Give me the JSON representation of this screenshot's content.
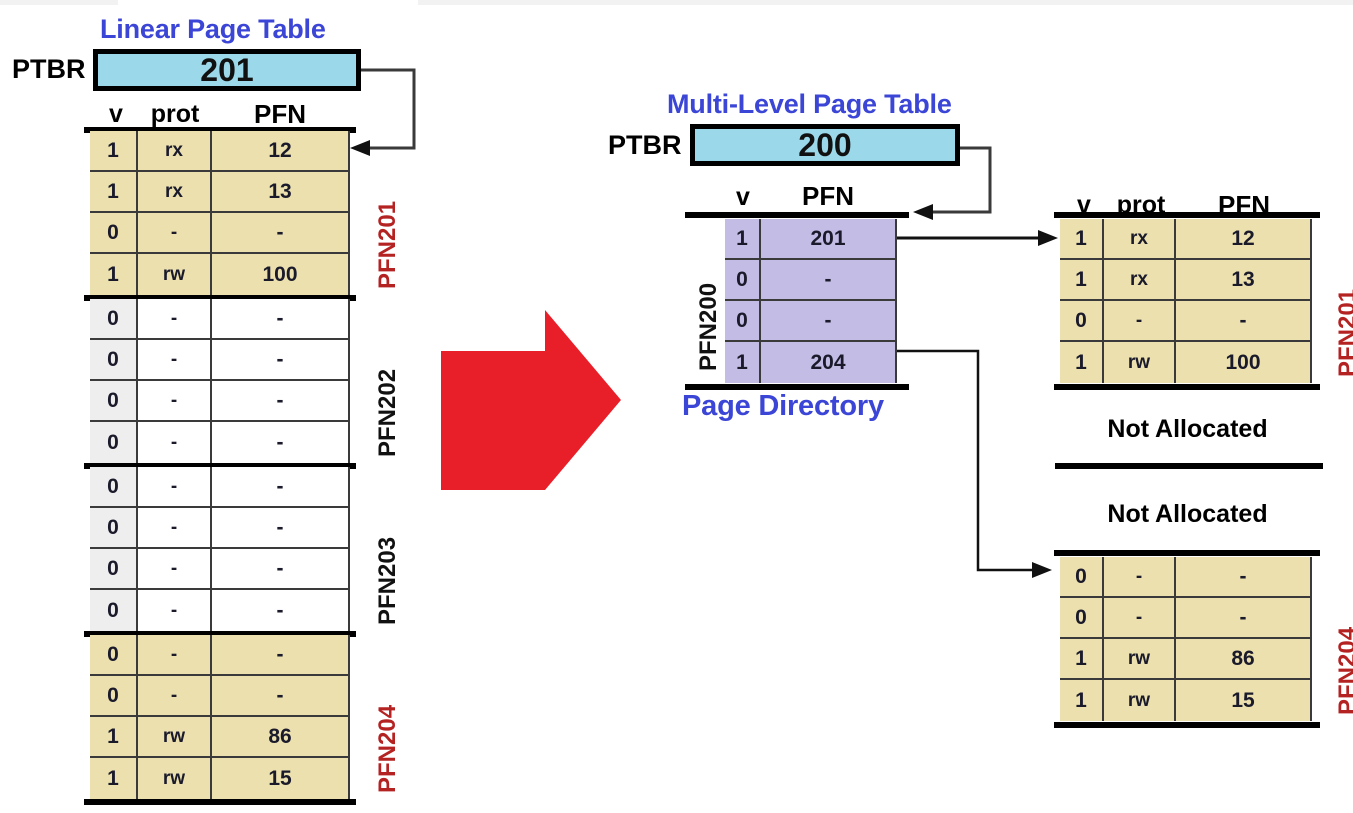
{
  "diagram": {
    "left_title": "Linear Page Table",
    "right_title": "Multi-Level Page Table",
    "page_directory_caption": "Page Directory",
    "not_allocated_1": "Not Allocated",
    "not_allocated_2": "Not Allocated",
    "arrow_icon_name": "red-right-arrow"
  },
  "colors": {
    "title_blue": "#3b45d6",
    "ptbr_fill": "#9bd9ea",
    "table_beige": "#ebe0ae",
    "table_purple": "#c3bce5",
    "table_white": "#ffffff",
    "pfn_label_red": "#b52222",
    "big_arrow_red": "#e81f29",
    "cell_border": "#3a3a3a",
    "section_bar": "#000000"
  },
  "linear": {
    "ptbr_label": "PTBR",
    "ptbr_value": "201",
    "headers": {
      "v": "v",
      "prot": "prot",
      "pfn": "PFN"
    },
    "sections": [
      {
        "pfn_label": "PFN201",
        "label_color": "red",
        "fill": "beige",
        "rows": [
          {
            "v": "1",
            "prot": "rx",
            "pfn": "12"
          },
          {
            "v": "1",
            "prot": "rx",
            "pfn": "13"
          },
          {
            "v": "0",
            "prot": "-",
            "pfn": "-"
          },
          {
            "v": "1",
            "prot": "rw",
            "pfn": "100"
          }
        ]
      },
      {
        "pfn_label": "PFN202",
        "label_color": "black",
        "fill": "white",
        "rows": [
          {
            "v": "0",
            "prot": "-",
            "pfn": "-"
          },
          {
            "v": "0",
            "prot": "-",
            "pfn": "-"
          },
          {
            "v": "0",
            "prot": "-",
            "pfn": "-"
          },
          {
            "v": "0",
            "prot": "-",
            "pfn": "-"
          }
        ]
      },
      {
        "pfn_label": "PFN203",
        "label_color": "black",
        "fill": "white",
        "rows": [
          {
            "v": "0",
            "prot": "-",
            "pfn": "-"
          },
          {
            "v": "0",
            "prot": "-",
            "pfn": "-"
          },
          {
            "v": "0",
            "prot": "-",
            "pfn": "-"
          },
          {
            "v": "0",
            "prot": "-",
            "pfn": "-"
          }
        ]
      },
      {
        "pfn_label": "PFN204",
        "label_color": "red",
        "fill": "beige",
        "rows": [
          {
            "v": "0",
            "prot": "-",
            "pfn": "-"
          },
          {
            "v": "0",
            "prot": "-",
            "pfn": "-"
          },
          {
            "v": "1",
            "prot": "rw",
            "pfn": "86"
          },
          {
            "v": "1",
            "prot": "rw",
            "pfn": "15"
          }
        ]
      }
    ]
  },
  "multilevel": {
    "ptbr_label": "PTBR",
    "ptbr_value": "200",
    "directory": {
      "pfn_label": "PFN200",
      "headers": {
        "v": "v",
        "pfn": "PFN"
      },
      "rows": [
        {
          "v": "1",
          "pfn": "201"
        },
        {
          "v": "0",
          "pfn": "-"
        },
        {
          "v": "0",
          "pfn": "-"
        },
        {
          "v": "1",
          "pfn": "204"
        }
      ]
    },
    "leaf_tables": [
      {
        "pfn_label": "PFN201",
        "headers": {
          "v": "v",
          "prot": "prot",
          "pfn": "PFN"
        },
        "rows": [
          {
            "v": "1",
            "prot": "rx",
            "pfn": "12"
          },
          {
            "v": "1",
            "prot": "rx",
            "pfn": "13"
          },
          {
            "v": "0",
            "prot": "-",
            "pfn": "-"
          },
          {
            "v": "1",
            "prot": "rw",
            "pfn": "100"
          }
        ]
      },
      {
        "pfn_label": "PFN204",
        "headers": {
          "v": "v",
          "prot": "prot",
          "pfn": "PFN"
        },
        "rows": [
          {
            "v": "0",
            "prot": "-",
            "pfn": "-"
          },
          {
            "v": "0",
            "prot": "-",
            "pfn": "-"
          },
          {
            "v": "1",
            "prot": "rw",
            "pfn": "86"
          },
          {
            "v": "1",
            "prot": "rw",
            "pfn": "15"
          }
        ]
      }
    ]
  }
}
